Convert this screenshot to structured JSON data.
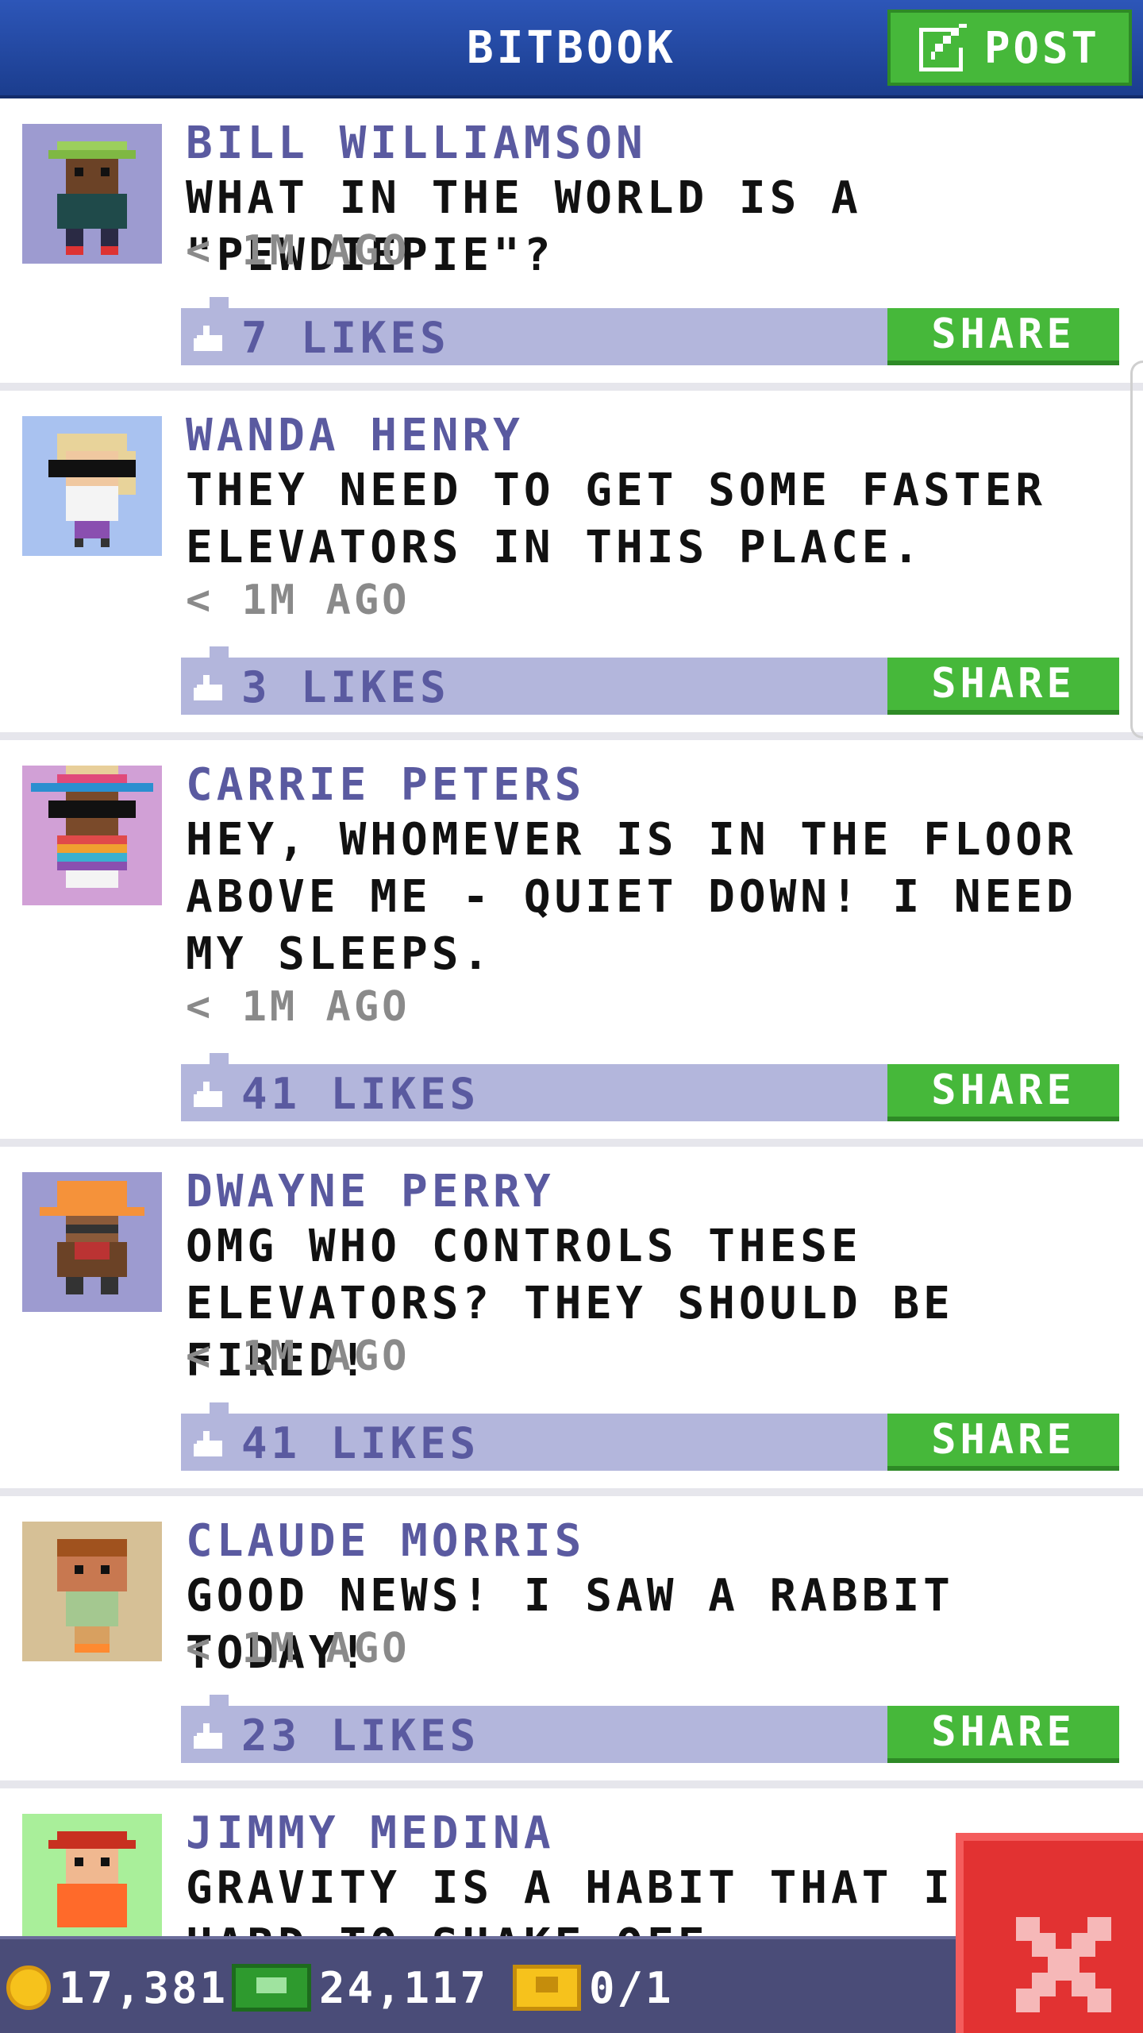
{
  "header": {
    "title": "BITBOOK",
    "post_label": "POST"
  },
  "posts": [
    {
      "author": "BILL WILLIAMSON",
      "message": "WHAT IN THE WORLD IS A \"PEWDIEPIE\"?",
      "time": "< 1M AGO",
      "likes": "7 LIKES",
      "share": "SHARE",
      "avatar_bg": "#9d9bd0"
    },
    {
      "author": "WANDA HENRY",
      "message": "THEY NEED TO GET SOME FASTER ELEVATORS IN THIS PLACE.",
      "time": "< 1M AGO",
      "likes": "3 LIKES",
      "share": "SHARE",
      "avatar_bg": "#a9c2f0"
    },
    {
      "author": "CARRIE PETERS",
      "message": "HEY, WHOMEVER IS IN THE FLOOR ABOVE ME - QUIET DOWN! I NEED MY SLEEPS.",
      "time": "< 1M AGO",
      "likes": "41 LIKES",
      "share": "SHARE",
      "avatar_bg": "#d1a0d6"
    },
    {
      "author": "DWAYNE PERRY",
      "message": "OMG WHO CONTROLS THESE ELEVATORS? THEY SHOULD BE FIRED!",
      "time": "< 1M AGO",
      "likes": "41 LIKES",
      "share": "SHARE",
      "avatar_bg": "#9d9bd0"
    },
    {
      "author": "CLAUDE MORRIS",
      "message": "GOOD NEWS! I SAW A RABBIT TODAY!",
      "time": "< 1M AGO",
      "likes": "23 LIKES",
      "share": "SHARE",
      "avatar_bg": "#d6c096"
    },
    {
      "author": "JIMMY MEDINA",
      "message": "GRAVITY IS A HABIT THAT IS HARD TO SHAKE OFF.",
      "time": "",
      "likes": "",
      "share": "",
      "avatar_bg": "#a9ef9a"
    }
  ],
  "status_bar": {
    "coins": "17,381",
    "bux": "24,117",
    "tickets": "0/1"
  },
  "icons": {
    "post": "edit-icon",
    "like": "thumbs-up-icon",
    "close": "close-icon",
    "coin": "coin-icon",
    "bux": "bux-icon",
    "ticket": "ticket-icon"
  },
  "colors": {
    "header": "#2d56b8",
    "accent_green": "#46b83a",
    "author": "#5a5aa0",
    "like_bar": "#b3b6dc",
    "close_red": "#e23232"
  }
}
